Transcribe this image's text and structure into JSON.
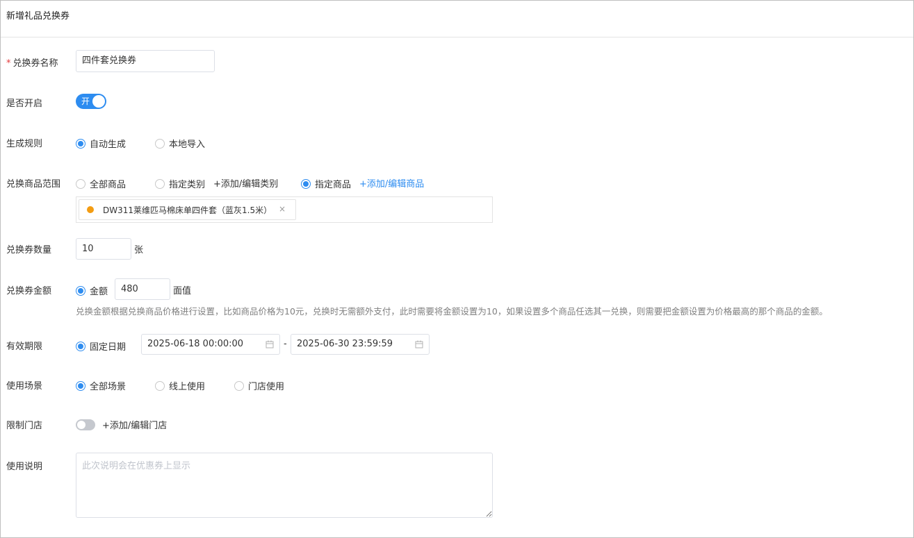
{
  "page": {
    "title": "新增礼品兑换券"
  },
  "colors": {
    "accent": "#2d8cf0",
    "required": "#e4393c",
    "tag_dot": "#f39c12"
  },
  "form": {
    "name": {
      "required_mark": "*",
      "label": "兑换券名称",
      "value": "四件套兑换券"
    },
    "enabled": {
      "label": "是否开启",
      "switch_text": "开",
      "on": true
    },
    "rule": {
      "label": "生成规则",
      "options": [
        "自动生成",
        "本地导入"
      ],
      "selected": "自动生成"
    },
    "scope": {
      "label": "兑换商品范围",
      "options": [
        "全部商品",
        "指定类别",
        "指定商品"
      ],
      "selected": "指定商品",
      "add_category_link": "+添加/编辑类别",
      "add_product_link": "+添加/编辑商品",
      "selected_products": [
        {
          "name": "DW311莱维匹马棉床单四件套（蓝灰1.5米）",
          "remove_icon": "×"
        }
      ]
    },
    "quantity": {
      "label": "兑换券数量",
      "value": "10",
      "unit": "张"
    },
    "amount": {
      "label": "兑换券金额",
      "option": "金额",
      "value": "480",
      "unit": "面值",
      "hint": "兑换金额根据兑换商品价格进行设置，比如商品价格为10元，兑换时无需额外支付，此时需要将金额设置为10，如果设置多个商品任选其一兑换，则需要把金额设置为价格最高的那个商品的金额。"
    },
    "validity": {
      "label": "有效期限",
      "option": "固定日期",
      "start": "2025-06-18 00:00:00",
      "separator": "-",
      "end": "2025-06-30 23:59:59"
    },
    "usage": {
      "label": "使用场景",
      "options": [
        "全部场景",
        "线上使用",
        "门店使用"
      ],
      "selected": "全部场景"
    },
    "store_limit": {
      "label": "限制门店",
      "on": false,
      "link": "+添加/编辑门店"
    },
    "instructions": {
      "label": "使用说明",
      "placeholder": "此次说明会在优惠券上显示",
      "value": ""
    }
  }
}
